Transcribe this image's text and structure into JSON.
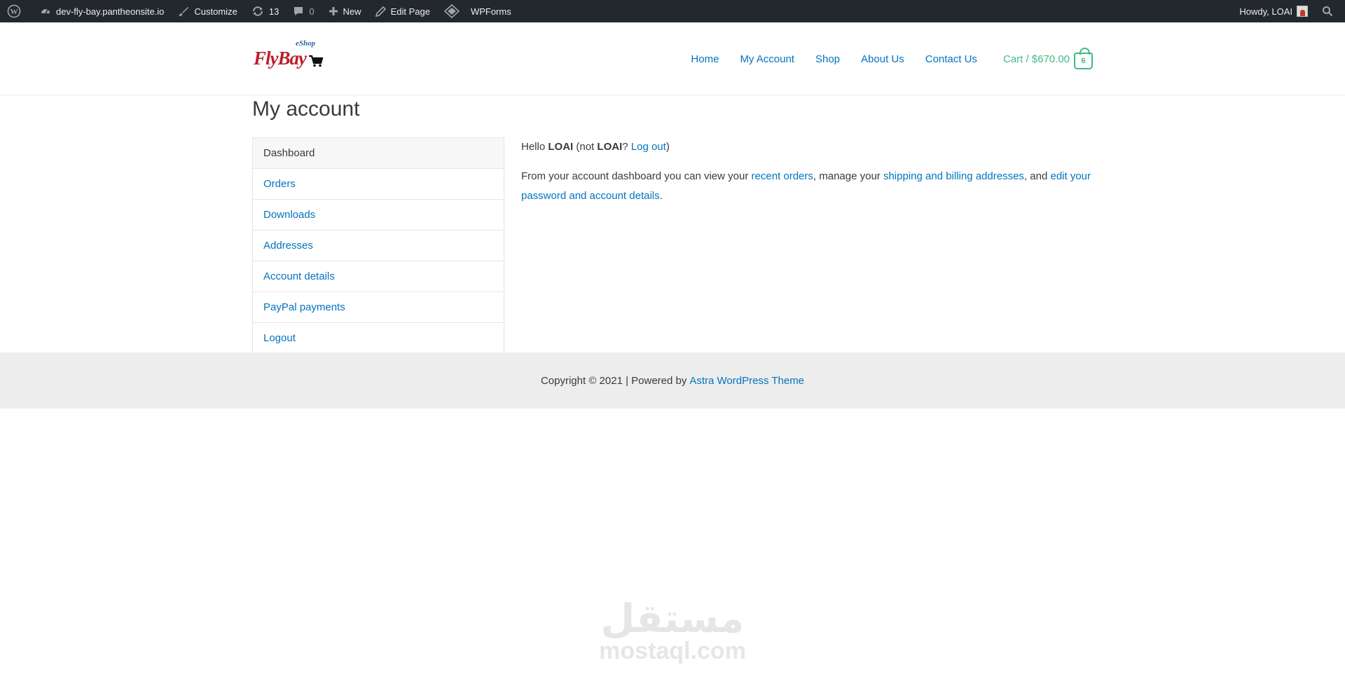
{
  "admin_bar": {
    "site_name": "dev-fly-bay.pantheonsite.io",
    "customize": "Customize",
    "updates_count": "13",
    "comments_count": "0",
    "new": "New",
    "edit_page": "Edit Page",
    "wpforms": "WPForms",
    "howdy": "Howdy, LOAI"
  },
  "logo": {
    "eshop": "eShop",
    "name": "FlyBay"
  },
  "nav": {
    "items": [
      "Home",
      "My Account",
      "Shop",
      "About Us",
      "Contact Us"
    ],
    "cart_label": "Cart / $670.00",
    "cart_count": "6",
    "link_color": "#0274be",
    "cart_color": "#3ebb84"
  },
  "page": {
    "title": "My account"
  },
  "account_nav": {
    "items": [
      "Dashboard",
      "Orders",
      "Downloads",
      "Addresses",
      "Account details",
      "PayPal payments",
      "Logout"
    ],
    "active": "Dashboard"
  },
  "content": {
    "hello": "Hello",
    "username": "LOAI",
    "not_open": "(not",
    "username2": "LOAI",
    "question": "?",
    "logout": "Log out",
    "close_paren": ")",
    "intro": "From your account dashboard you can view your",
    "recent_orders": "recent orders",
    "manage": ", manage your",
    "addresses_link": "shipping and billing addresses",
    "and": ", and",
    "edit_link": "edit your password and account details",
    "period": "."
  },
  "footer": {
    "text": "Copyright © 2021 | Powered by",
    "link": "Astra WordPress Theme"
  },
  "watermark": {
    "arabic": "مستقل",
    "latin": "mostaql.com"
  }
}
